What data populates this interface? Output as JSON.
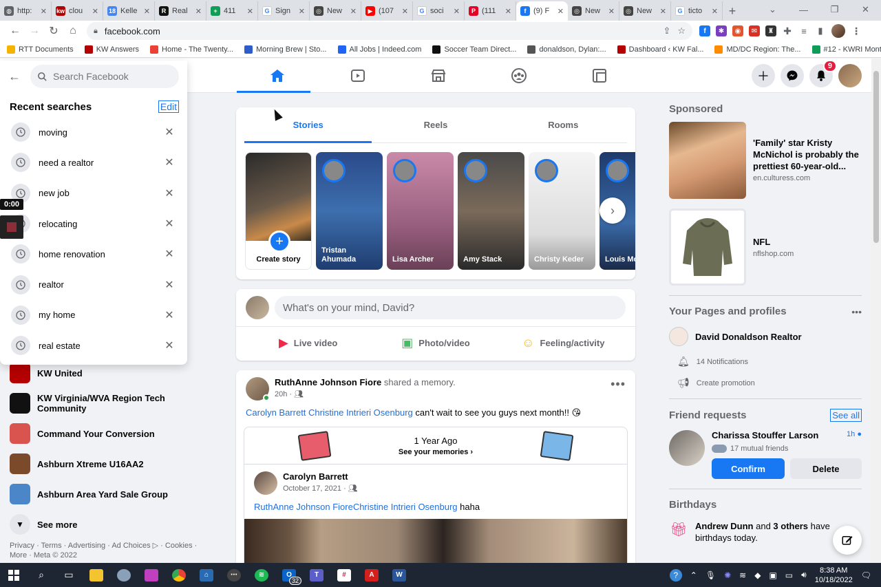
{
  "browser": {
    "tabs": [
      {
        "title": "http:",
        "color": "#5f6368",
        "glyph": "◍"
      },
      {
        "title": "clou",
        "color": "#b40000",
        "glyph": "kw"
      },
      {
        "title": "Kelle",
        "color": "#4285f4",
        "glyph": "18"
      },
      {
        "title": "Real",
        "color": "#111111",
        "glyph": "R"
      },
      {
        "title": "411",
        "color": "#0f9d58",
        "glyph": "+"
      },
      {
        "title": "Sign",
        "color": "#ffffff",
        "glyph": "G"
      },
      {
        "title": "New",
        "color": "#444444",
        "glyph": "◎"
      },
      {
        "title": "(107",
        "color": "#ff0000",
        "glyph": "▶"
      },
      {
        "title": "soci",
        "color": "#ffffff",
        "glyph": "G"
      },
      {
        "title": "(111",
        "color": "#e60023",
        "glyph": "P"
      },
      {
        "title": "(9) F",
        "color": "#1877f2",
        "glyph": "f",
        "active": true
      },
      {
        "title": "New",
        "color": "#444444",
        "glyph": "◎"
      },
      {
        "title": "New",
        "color": "#444444",
        "glyph": "◎"
      },
      {
        "title": "ticto",
        "color": "#ffffff",
        "glyph": "G"
      }
    ],
    "new_tab": "+",
    "url": "facebook.com",
    "bookmarks": [
      {
        "label": "RTT Documents",
        "color": "#f4b400"
      },
      {
        "label": "KW Answers",
        "color": "#b40000"
      },
      {
        "label": "Home - The Twenty...",
        "color": "#e94235"
      },
      {
        "label": "Morning Brew | Sto...",
        "color": "#2c5dc9"
      },
      {
        "label": "All Jobs | Indeed.com",
        "color": "#2164f3"
      },
      {
        "label": "Soccer Team Direct...",
        "color": "#111111"
      },
      {
        "label": "donaldson, Dylan:...",
        "color": "#555555"
      },
      {
        "label": "Dashboard ‹ KW Fal...",
        "color": "#b40000"
      },
      {
        "label": "MD/DC Region: The...",
        "color": "#ff8c00"
      },
      {
        "label": "#12 - KWRI Monthl...",
        "color": "#0f9d58"
      }
    ]
  },
  "fb": {
    "notif_count": "9",
    "search_placeholder": "Search Facebook",
    "recent_title": "Recent searches",
    "edit_label": "Edit",
    "recent": [
      "moving",
      "need a realtor",
      "new job",
      "relocating",
      "home renovation",
      "realtor",
      "my home",
      "real estate"
    ],
    "timer": "0:00",
    "left_items": [
      {
        "label": "KW United",
        "color": "#b40000"
      },
      {
        "label": "KW Virginia/WVA Region Tech Community",
        "color": "#111111"
      },
      {
        "label": "Command Your Conversion",
        "color": "#d9534f"
      },
      {
        "label": "Ashburn Xtreme U16AA2",
        "color": "#7a4a2a"
      },
      {
        "label": "Ashburn Area Yard Sale Group",
        "color": "#4a86c8"
      }
    ],
    "see_more": "See more",
    "footer": "Privacy · Terms · Advertising · Ad Choices ▷ · Cookies · More · Meta © 2022",
    "story_tabs": [
      "Stories",
      "Reels",
      "Rooms"
    ],
    "create_story": "Create story",
    "stories": [
      {
        "name": "Tristan Ahumada",
        "bg": "linear-gradient(180deg,#2b4a8a,#3d6fae 50%,#1f3d70)"
      },
      {
        "name": "Lisa Archer",
        "bg": "linear-gradient(180deg,#c98aa8,#9a6080 60%,#6a4058)"
      },
      {
        "name": "Amy Stack",
        "bg": "linear-gradient(180deg,#4a4a4a,#7a6a5a 50%,#2a2a2a)"
      },
      {
        "name": "Christy Keder",
        "bg": "linear-gradient(180deg,#f5f5f5,#dcdcdc 70%,#9a9a9a)"
      },
      {
        "name": "Louis Montant",
        "bg": "linear-gradient(180deg,#1e3a6a,#3a6aa8 60%,#1a2a4a)"
      }
    ],
    "composer_placeholder": "What's on your mind, David?",
    "composer_actions": [
      {
        "label": "Live video",
        "icon": "▶",
        "color": "#f02849"
      },
      {
        "label": "Photo/video",
        "icon": "▣",
        "color": "#45bd62"
      },
      {
        "label": "Feeling/activity",
        "icon": "☺",
        "color": "#f7b928"
      }
    ],
    "post": {
      "author": "RuthAnne Johnson Fiore",
      "action": "shared a memory.",
      "time": "20h",
      "tags": "Carolyn Barrett Christine Intrieri Osenburg",
      "text": "can't wait to see you guys next month!! 😘",
      "memory_title": "1 Year Ago",
      "memory_sub": "See your memories",
      "inner_author": "Carolyn Barrett",
      "inner_date": "October 17, 2021",
      "inner_tags": "RuthAnne Johnson FioreChristine Intrieri Osenburg",
      "inner_text": "haha"
    },
    "sponsored_title": "Sponsored",
    "ads": [
      {
        "title": "'Family' star Kristy McNichol is probably the prettiest 60-year-old...",
        "url": "en.culturess.com"
      },
      {
        "title": "NFL",
        "url": "nflshop.com"
      }
    ],
    "pages_title": "Your Pages and profiles",
    "page_name": "David Donaldson Realtor",
    "page_notifs": "14 Notifications",
    "page_promo": "Create promotion",
    "friend_title": "Friend requests",
    "see_all": "See all",
    "friend": {
      "name": "Charissa Stouffer Larson",
      "time": "1h",
      "mutual": "17 mutual friends"
    },
    "confirm": "Confirm",
    "delete": "Delete",
    "bday_title": "Birthdays",
    "bday_text_a": "Andrew Dunn",
    "bday_text_b": " and ",
    "bday_text_c": "3 others",
    "bday_text_d": " have birthdays today."
  },
  "taskbar": {
    "time": "8:38 AM",
    "date": "10/18/2022",
    "teams_count": "32"
  }
}
